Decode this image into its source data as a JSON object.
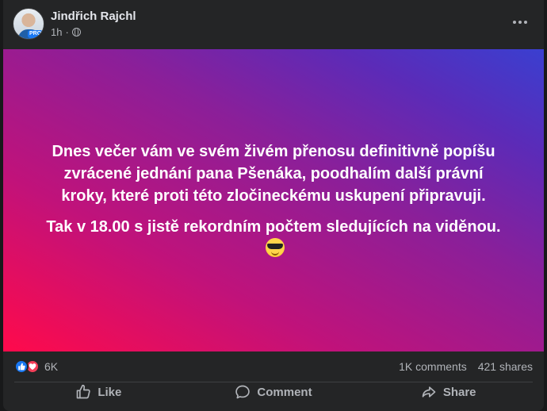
{
  "post": {
    "author": "Jindřich Rajchl",
    "time": "1h",
    "avatar_badge": "PRO",
    "text_paragraph_1": "Dnes večer vám ve svém živém přenosu definitivně popíšu zvrácené jednání pana Pšenáka, poodhalím další právní kroky, které proti této zločineckému uskupení připravuji.",
    "text_paragraph_2": "Tak v 18.00 s jistě rekordním počtem sledujících na viděnou.",
    "emoji": "smiling-face-with-sunglasses",
    "background_colors": [
      "#ff0a4b",
      "#c1127a",
      "#8b1f99",
      "#3a3fd0"
    ]
  },
  "stats": {
    "reaction_count": "6K",
    "comments": "1K comments",
    "shares": "421 shares"
  },
  "actions": {
    "like": "Like",
    "comment": "Comment",
    "share": "Share"
  },
  "icons": [
    "globe-icon",
    "more-options-icon",
    "like-reaction-icon",
    "love-reaction-icon",
    "like-icon",
    "comment-icon",
    "share-icon"
  ]
}
